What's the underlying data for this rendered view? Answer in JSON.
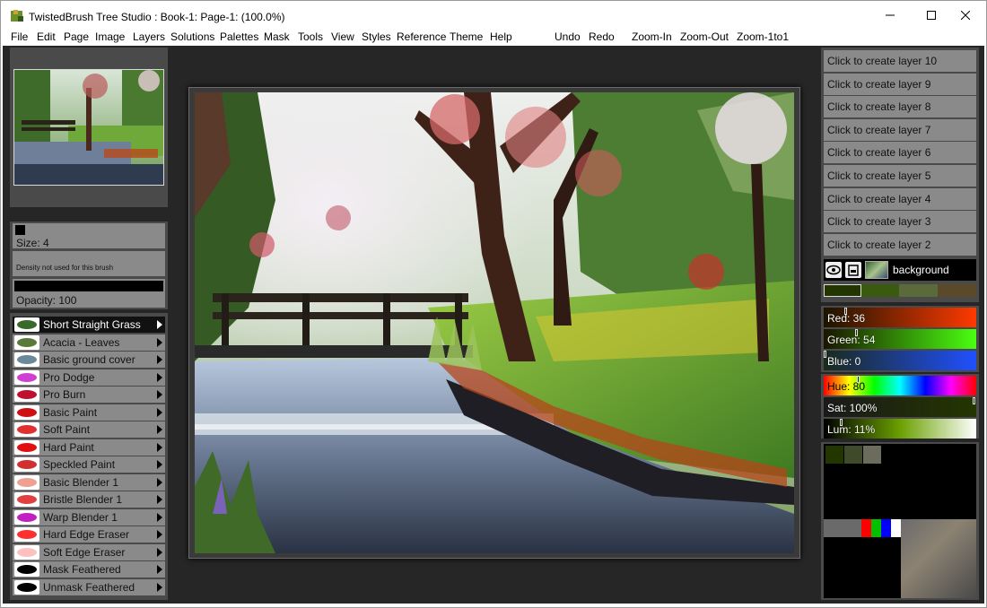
{
  "window": {
    "title": "TwistedBrush Tree Studio : Book-1: Page-1:  (100.0%)",
    "icon": "twistedbrush-app-icon"
  },
  "menu": [
    {
      "label": "File"
    },
    {
      "label": "Edit"
    },
    {
      "label": "Page"
    },
    {
      "label": "Image"
    },
    {
      "label": "Layers"
    },
    {
      "label": "Solutions"
    },
    {
      "label": "Palettes"
    },
    {
      "label": "Mask"
    },
    {
      "label": "Tools"
    },
    {
      "label": "View"
    },
    {
      "label": "Styles"
    },
    {
      "label": "Reference"
    },
    {
      "label": "Theme"
    },
    {
      "label": "Help"
    },
    {
      "label": "Undo"
    },
    {
      "label": "Redo"
    },
    {
      "label": "Zoom-In"
    },
    {
      "label": "Zoom-Out"
    },
    {
      "label": "Zoom-1to1"
    }
  ],
  "brush_settings": {
    "size_label": "Size: 4",
    "density_label": "Density not used for this brush",
    "opacity_label": "Opacity: 100"
  },
  "brushes": [
    {
      "label": "Short Straight Grass",
      "selected": true,
      "icon": "grass-brush-icon"
    },
    {
      "label": "Acacia - Leaves",
      "icon": "leaves-brush-icon"
    },
    {
      "label": "Basic ground cover",
      "icon": "ground-cover-brush-icon"
    },
    {
      "label": "Pro Dodge",
      "icon": "dodge-brush-icon"
    },
    {
      "label": "Pro Burn",
      "icon": "burn-brush-icon"
    },
    {
      "label": "Basic Paint",
      "icon": "paint-brush-icon"
    },
    {
      "label": "Soft Paint",
      "icon": "soft-paint-brush-icon"
    },
    {
      "label": "Hard Paint",
      "icon": "hard-paint-brush-icon"
    },
    {
      "label": "Speckled Paint",
      "icon": "speckled-paint-brush-icon"
    },
    {
      "label": "Basic Blender 1",
      "icon": "blender-brush-icon"
    },
    {
      "label": "Bristle Blender 1",
      "icon": "bristle-blender-brush-icon"
    },
    {
      "label": "Warp Blender 1",
      "icon": "warp-blender-brush-icon"
    },
    {
      "label": "Hard Edge Eraser",
      "icon": "hard-eraser-brush-icon"
    },
    {
      "label": "Soft Edge Eraser",
      "icon": "soft-eraser-brush-icon"
    },
    {
      "label": "Mask Feathered",
      "icon": "mask-brush-icon"
    },
    {
      "label": "Unmask Feathered",
      "icon": "unmask-brush-icon"
    }
  ],
  "layers": {
    "create_buttons": [
      "Click to create layer 10",
      "Click to create layer 9",
      "Click to create layer 8",
      "Click to create layer 7",
      "Click to create layer 6",
      "Click to create layer 5",
      "Click to create layer 4",
      "Click to create layer 3",
      "Click to create layer 2"
    ],
    "background_label": "background"
  },
  "color": {
    "red_label": "Red: 36",
    "green_label": "Green: 54",
    "blue_label": "Blue: 0",
    "hue_label": "Hue: 80",
    "sat_label": "Sat: 100%",
    "lum_label": "Lum: 11%",
    "red": 36,
    "green": 54,
    "blue": 0,
    "hue": 80,
    "sat_pct": 100,
    "lum_pct": 11,
    "current_hex": "#243600"
  },
  "palette_colors": [
    "#243600",
    "#3e4a2a",
    "#6b6b5e"
  ],
  "mix_colors": [
    "#6a6a6a",
    "#ff0000",
    "#00c000",
    "#0000ff",
    "#ffffff"
  ],
  "swatch_colors": [
    "#243600",
    "#3a5a10",
    "#5a6a3a",
    "#5a4a2a"
  ]
}
